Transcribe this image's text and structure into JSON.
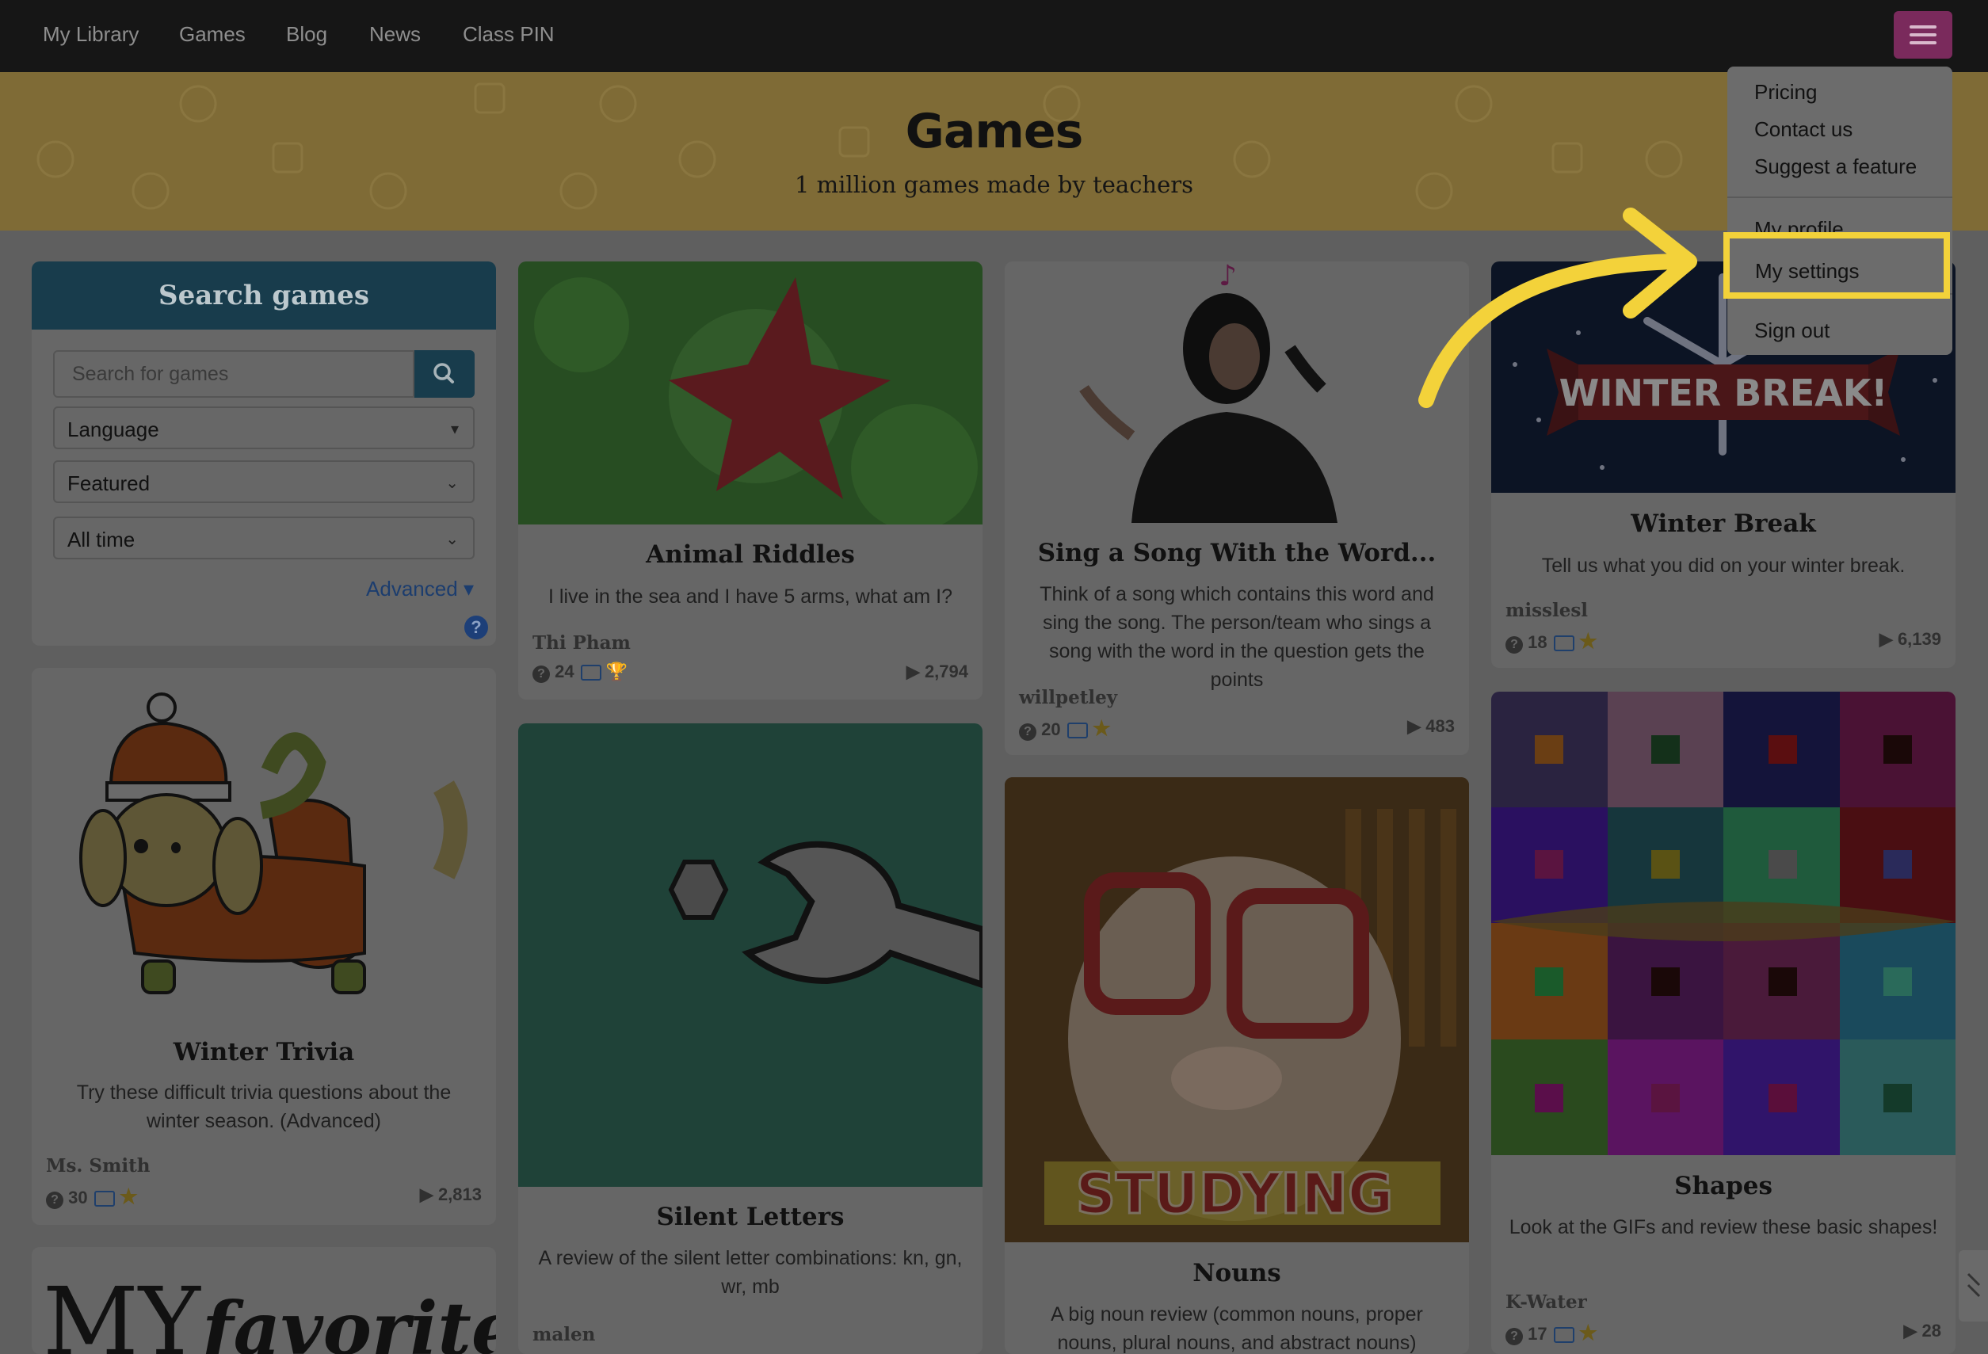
{
  "nav": {
    "links": [
      "My Library",
      "Games",
      "Blog",
      "News",
      "Class PIN"
    ]
  },
  "banner": {
    "title": "Games",
    "subtitle": "1 million games made by teachers"
  },
  "search": {
    "heading": "Search games",
    "placeholder": "Search for games",
    "language": "Language",
    "sort": "Featured",
    "time": "All time",
    "advanced": "Advanced"
  },
  "dropdown": {
    "items": [
      "Pricing",
      "Contact us",
      "Suggest a feature",
      "My profile",
      "My settings",
      "Sign out"
    ]
  },
  "cards": [
    {
      "title": "Animal Riddles",
      "desc": "I live in the sea and I have 5 arms, what am I?",
      "author": "Thi Pham",
      "questions": "24",
      "plays": "2,794"
    },
    {
      "title": "Sing a Song With the Word...",
      "desc": "Think of a song which contains this word and sing the song. The person/team who sings a song with the word in the question gets the points",
      "author": "willpetley",
      "questions": "20",
      "plays": "483"
    },
    {
      "title": "Winter Break",
      "desc": "Tell us what you did on your winter break.",
      "author": "misslesl",
      "questions": "18",
      "plays": "6,139",
      "banner_text": "WINTER BREAK!"
    },
    {
      "title": "Winter Trivia",
      "desc": "Try these difficult trivia questions about the winter season. (Advanced)",
      "author": "Ms. Smith",
      "questions": "30",
      "plays": "2,813"
    },
    {
      "title": "Silent Letters",
      "desc": "A review of the silent letter combinations: kn, gn, wr, mb",
      "author": "malen"
    },
    {
      "title": "Nouns",
      "desc": "A big noun review (common nouns, proper nouns, plural nouns, and abstract nouns)",
      "image_text": "STUDYING"
    },
    {
      "title": "Shapes",
      "desc": "Look at the GIFs and review these basic shapes!",
      "author": "K-Water",
      "questions": "17",
      "plays": "28"
    },
    {
      "image_text_1": "MY",
      "image_text_2": "favorite"
    }
  ],
  "colors": {
    "highlight": "#f3d23a",
    "arrow": "#f3d23a",
    "menu_button": "#7a2a5c",
    "search_header": "#183c4c"
  }
}
